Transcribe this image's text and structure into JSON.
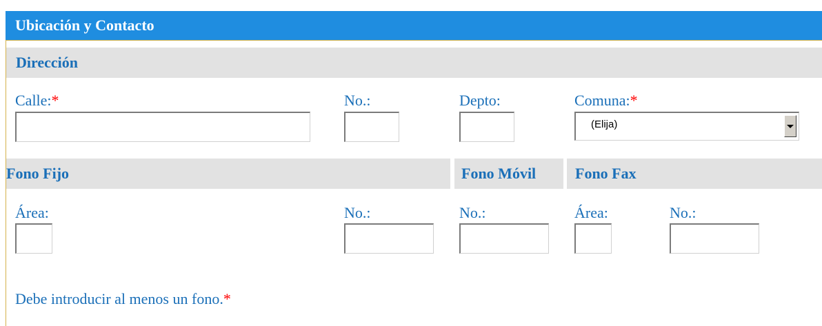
{
  "header": {
    "title": "Ubicación y Contacto"
  },
  "direccion": {
    "section_title": "Dirección",
    "calle_label": "Calle:",
    "calle_value": "",
    "no_label": "No.:",
    "no_value": "",
    "depto_label": "Depto:",
    "depto_value": "",
    "comuna_label": "Comuna:",
    "comuna_selected": "(Elija)"
  },
  "telefonos": {
    "fijo_title": "Fono Fijo",
    "movil_title": "Fono Móvil",
    "fax_title": "Fono Fax",
    "fijo_area_label": "Área:",
    "fijo_no_label": "No.:",
    "movil_no_label": "No.:",
    "fax_area_label": "Área:",
    "fax_no_label": "No.:"
  },
  "footer": {
    "note": "Debe introducir al menos un fono."
  },
  "required_marker": "*",
  "colors": {
    "header_bg": "#1f8de0",
    "label": "#1a6fb8",
    "required": "#ff0000",
    "section_bg": "#e2e2e2"
  }
}
